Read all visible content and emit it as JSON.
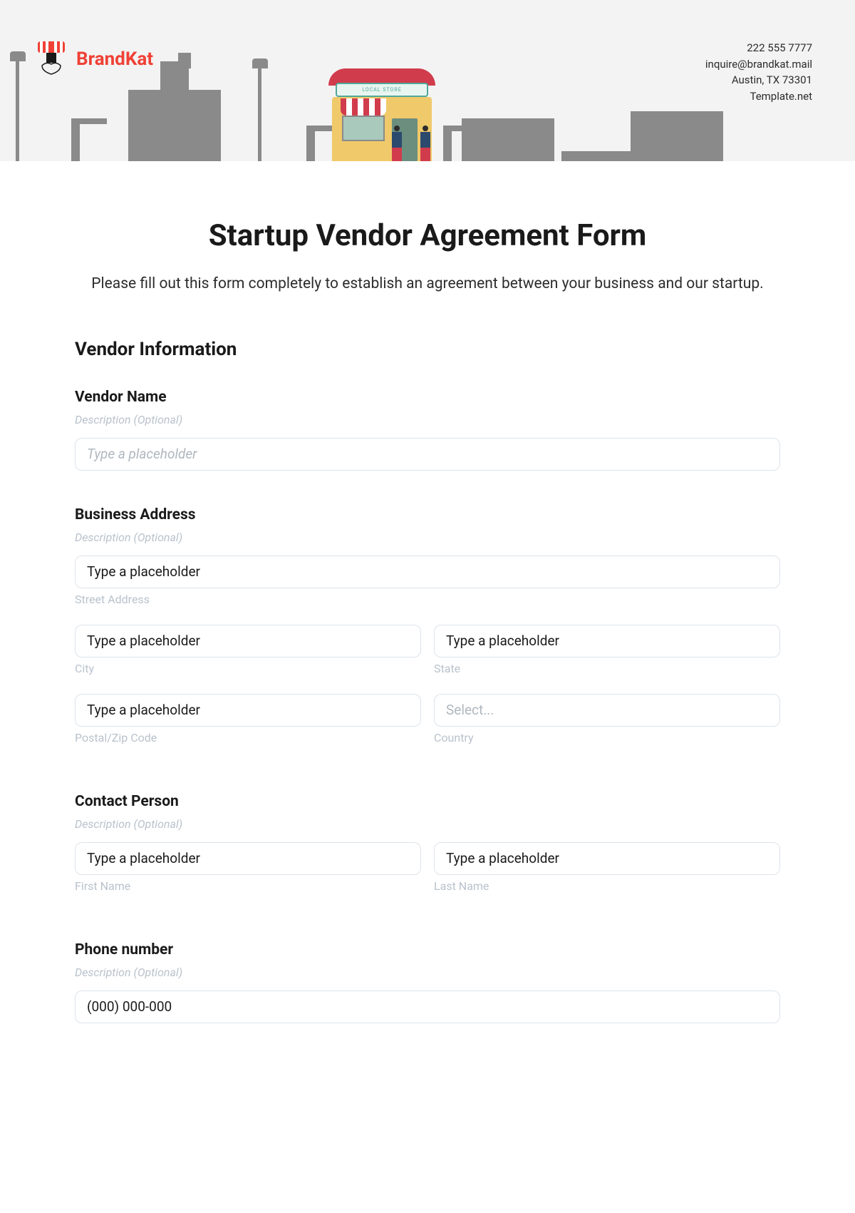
{
  "header": {
    "brand_name": "BrandKat",
    "store_sign": "LOCAL STORE",
    "contact": {
      "phone": "222 555 7777",
      "email": "inquire@brandkat.mail",
      "address": "Austin, TX 73301",
      "site": "Template.net"
    }
  },
  "form": {
    "title": "Startup Vendor Agreement Form",
    "subtitle": "Please fill out this form completely to establish an agreement between your business and our startup.",
    "section_vendor_info": "Vendor Information",
    "vendor_name": {
      "label": "Vendor Name",
      "desc": "Description (Optional)",
      "placeholder": "Type a placeholder"
    },
    "business_address": {
      "label": "Business Address",
      "desc": "Description (Optional)",
      "street_ph": "Type a placeholder",
      "street_sub": "Street Address",
      "city_ph": "Type a placeholder",
      "city_sub": "City",
      "state_ph": "Type a placeholder",
      "state_sub": "State",
      "postal_ph": "Type a placeholder",
      "postal_sub": "Postal/Zip Code",
      "country_ph": "Select...",
      "country_sub": "Country"
    },
    "contact_person": {
      "label": "Contact Person",
      "desc": "Description (Optional)",
      "first_ph": "Type a placeholder",
      "first_sub": "First Name",
      "last_ph": "Type a placeholder",
      "last_sub": "Last Name"
    },
    "phone": {
      "label": "Phone number",
      "desc": "Description (Optional)",
      "placeholder": "(000) 000-000"
    }
  }
}
